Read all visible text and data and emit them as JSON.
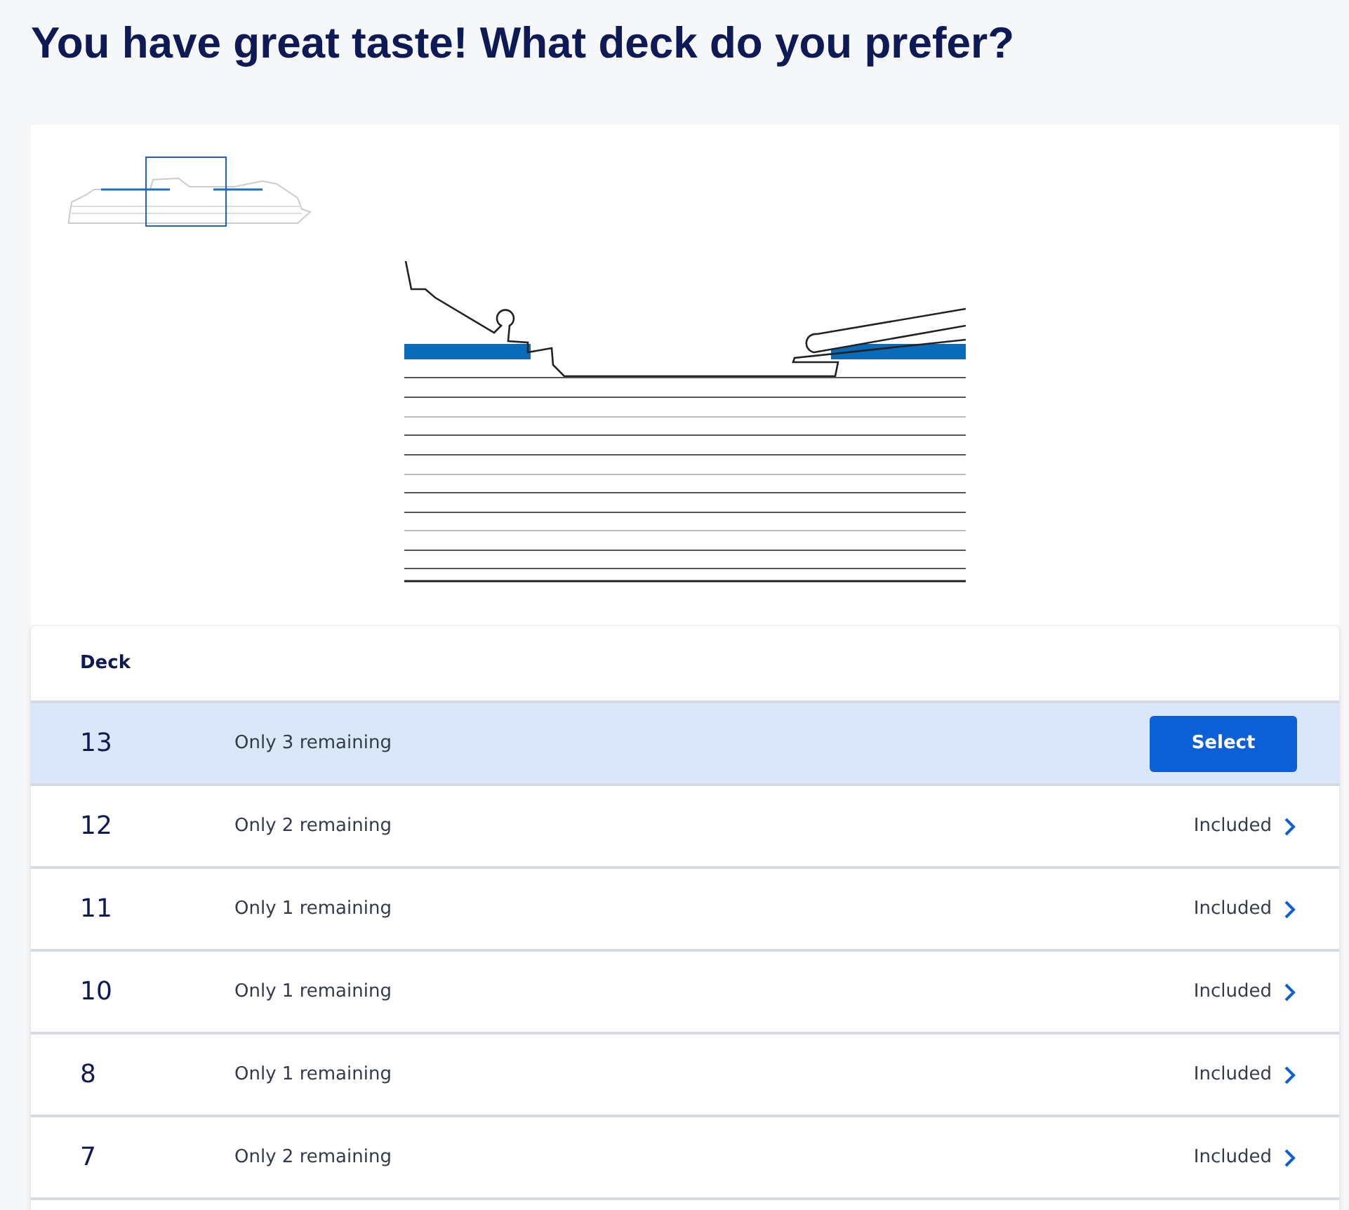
{
  "heading": "You have great taste! What deck do you prefer?",
  "table": {
    "columns": [
      "Deck"
    ],
    "rows": [
      {
        "deck": "13",
        "availability": "Only 3 remaining",
        "selected": true,
        "action": "Select"
      },
      {
        "deck": "12",
        "availability": "Only 2 remaining",
        "selected": false,
        "action": "Included"
      },
      {
        "deck": "11",
        "availability": "Only 1 remaining",
        "selected": false,
        "action": "Included"
      },
      {
        "deck": "10",
        "availability": "Only 1 remaining",
        "selected": false,
        "action": "Included"
      },
      {
        "deck": "8",
        "availability": "Only 1 remaining",
        "selected": false,
        "action": "Included"
      },
      {
        "deck": "7",
        "availability": "Only 2 remaining",
        "selected": false,
        "action": "Included"
      }
    ]
  }
}
